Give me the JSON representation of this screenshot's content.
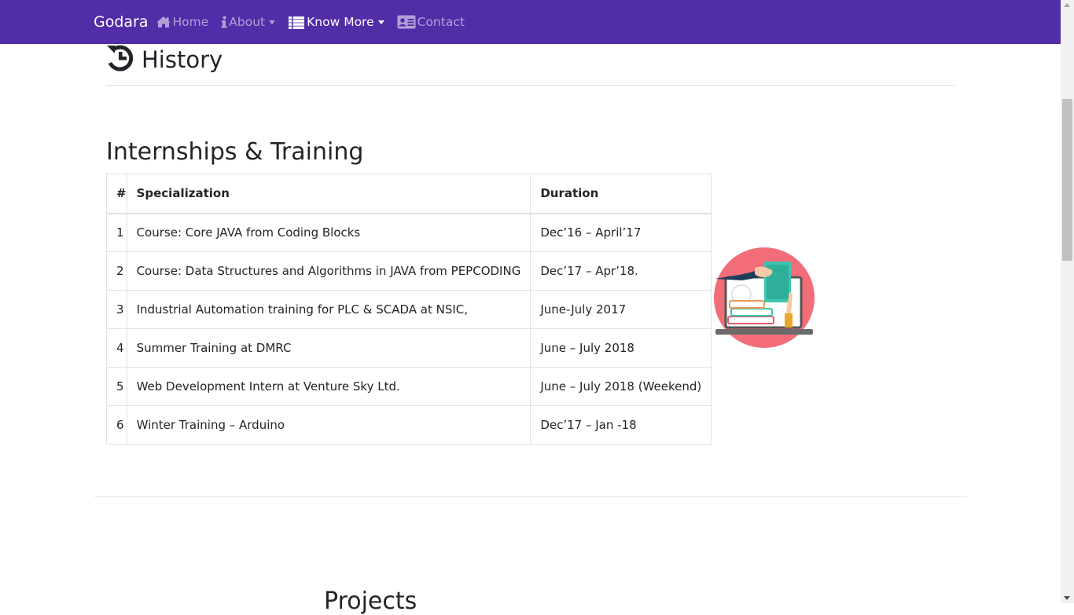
{
  "nav": {
    "brand": "Godara",
    "home": "Home",
    "about": "About",
    "know_more": "Know More",
    "contact": "Contact"
  },
  "history": {
    "title": "History"
  },
  "training": {
    "title": "Internships & Training",
    "headers": [
      "#",
      "Specialization",
      "Duration"
    ],
    "rows": [
      [
        "1",
        "Course: Core JAVA from Coding Blocks",
        "Dec’16 – April’17"
      ],
      [
        "2",
        "Course: Data Structures and Algorithms in JAVA from PEPCODING",
        "Dec’17 – Apr’18."
      ],
      [
        "3",
        "Industrial Automation training for PLC & SCADA at NSIC,",
        "June-July 2017"
      ],
      [
        "4",
        "Summer Training at DMRC",
        "June – July 2018"
      ],
      [
        "5",
        "Web Development Intern at Venture Sky Ltd.",
        "June – July 2018 (Weekend)"
      ],
      [
        "6",
        "Winter Training – Arduino",
        "Dec’17 – Jan -18"
      ]
    ]
  },
  "projects": {
    "title": "Projects"
  },
  "colors": {
    "navbar": "#512da8",
    "illustration_circle": "#f26d78",
    "book_teal": "#3cc5b0"
  },
  "icons": {
    "home": "home-icon",
    "about": "info-icon",
    "know_more": "list-icon",
    "contact": "address-card-icon",
    "history": "history-icon"
  }
}
